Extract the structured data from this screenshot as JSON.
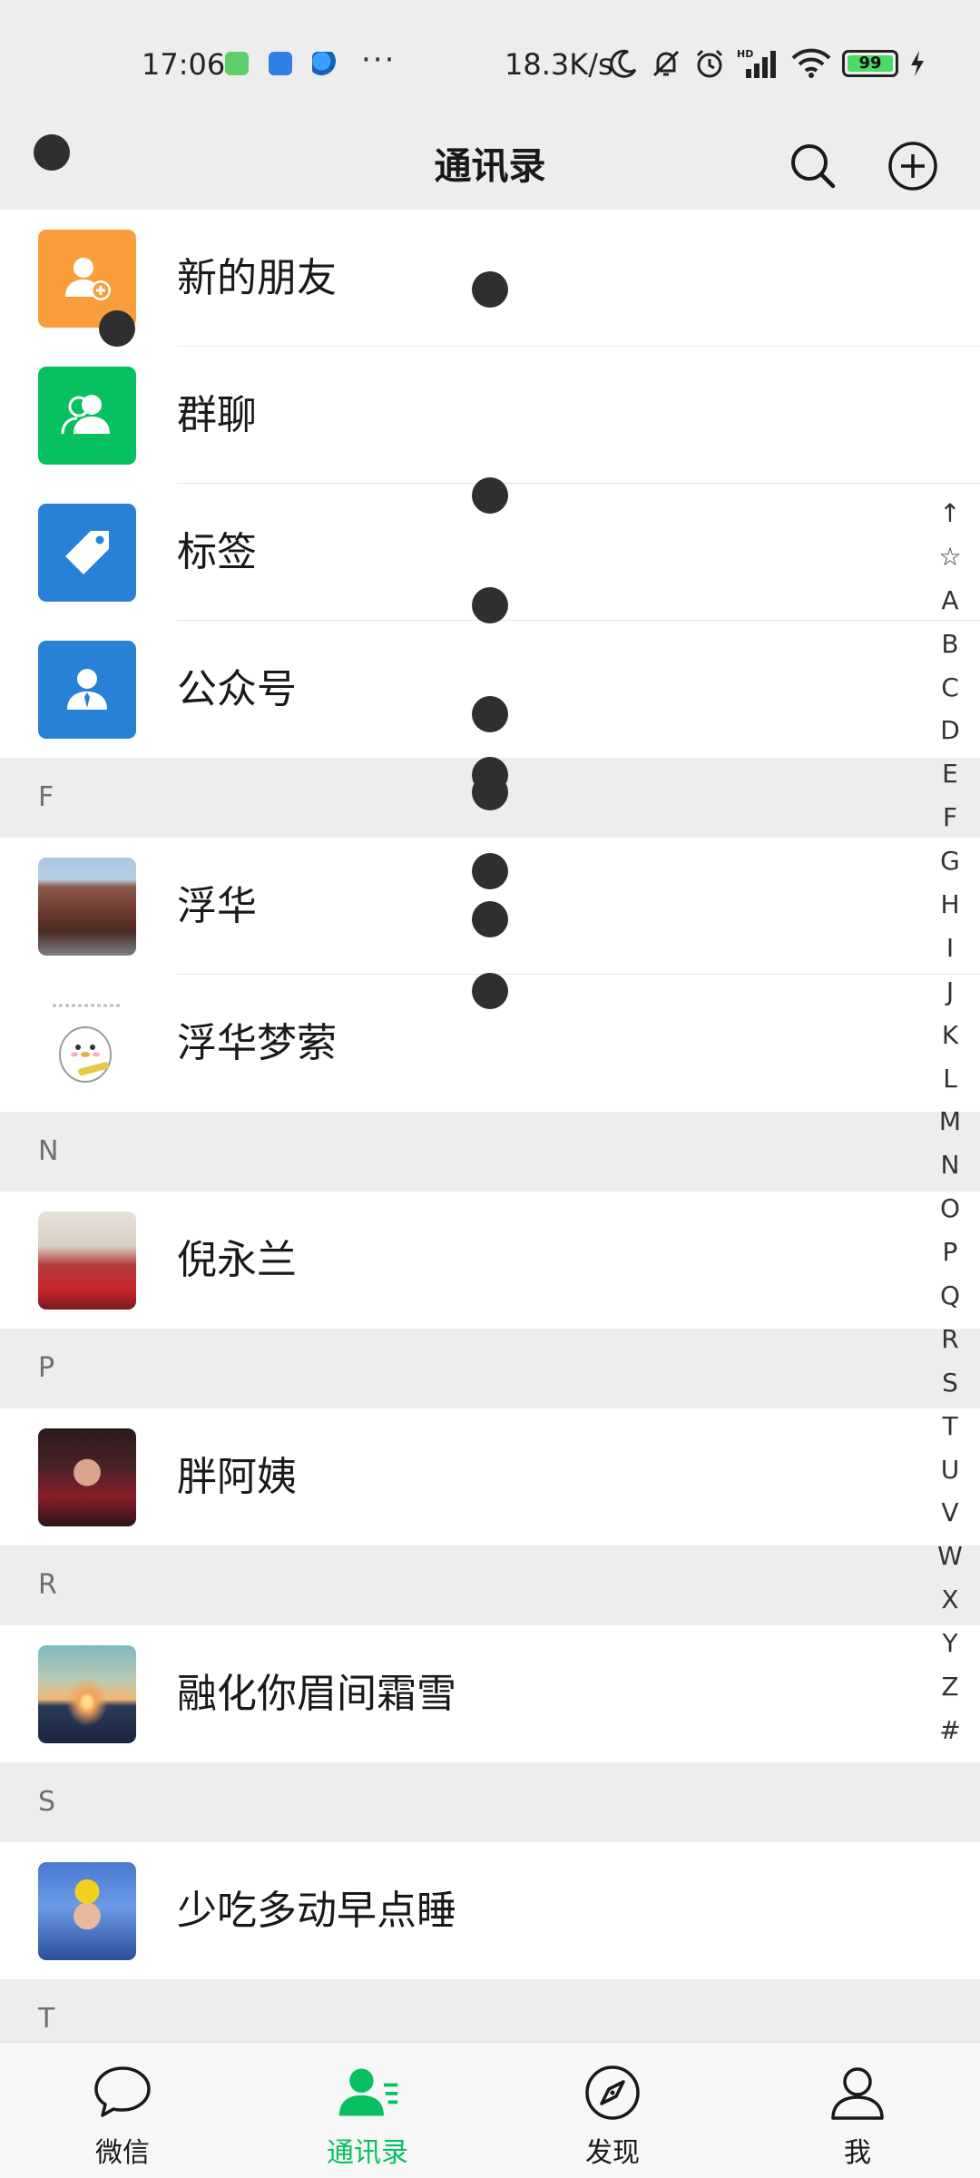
{
  "status_bar": {
    "time": "17:06",
    "more": "···",
    "network_speed": "18.3K/s",
    "battery_level": "99",
    "icons": [
      "app-notification-green-icon",
      "app-notification-blue-icon",
      "app-notification-browser-icon",
      "moon-icon",
      "bell-off-icon",
      "alarm-icon",
      "hd-signal-icon",
      "wifi-icon",
      "battery-icon",
      "charging-icon"
    ]
  },
  "header": {
    "title": "通讯录",
    "search_icon": "search-icon",
    "add_icon": "plus-circle-icon"
  },
  "functions": [
    {
      "label": "新的朋友",
      "icon": "add-friend-icon",
      "color": "#fa9d3b"
    },
    {
      "label": "群聊",
      "icon": "group-chat-icon",
      "color": "#07c160"
    },
    {
      "label": "标签",
      "icon": "tag-icon",
      "color": "#2782d7"
    },
    {
      "label": "公众号",
      "icon": "official-account-icon",
      "color": "#2782d7"
    }
  ],
  "sections": [
    {
      "letter": "F",
      "contacts": [
        {
          "name": "浮华"
        },
        {
          "name": "浮华梦萦"
        }
      ]
    },
    {
      "letter": "N",
      "contacts": [
        {
          "name": "倪永兰"
        }
      ]
    },
    {
      "letter": "P",
      "contacts": [
        {
          "name": "胖阿姨"
        }
      ]
    },
    {
      "letter": "R",
      "contacts": [
        {
          "name": "融化你眉间霜雪"
        }
      ]
    },
    {
      "letter": "S",
      "contacts": [
        {
          "name": "少吃多动早点睡"
        }
      ]
    },
    {
      "letter": "T",
      "contacts": []
    }
  ],
  "alphabet_index": [
    "↑",
    "☆",
    "A",
    "B",
    "C",
    "D",
    "E",
    "F",
    "G",
    "H",
    "I",
    "J",
    "K",
    "L",
    "M",
    "N",
    "O",
    "P",
    "Q",
    "R",
    "S",
    "T",
    "U",
    "V",
    "W",
    "X",
    "Y",
    "Z",
    "#"
  ],
  "tabs": [
    {
      "label": "微信",
      "icon": "chat-bubble-icon",
      "active": false
    },
    {
      "label": "通讯录",
      "icon": "contacts-icon",
      "active": true
    },
    {
      "label": "发现",
      "icon": "compass-icon",
      "active": false
    },
    {
      "label": "我",
      "icon": "profile-icon",
      "active": false
    }
  ],
  "colors": {
    "accent": "#07c160",
    "background": "#ededed",
    "orange": "#fa9d3b",
    "blue": "#2782d7"
  }
}
